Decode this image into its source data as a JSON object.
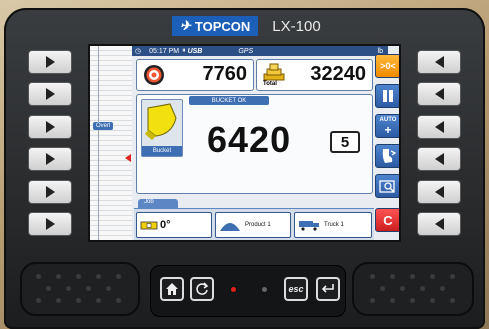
{
  "brand": {
    "logo_text": "TOPCON",
    "model": "LX-100"
  },
  "status_bar": {
    "time": "05:17 PM",
    "usb": "USB",
    "gps": "GPS",
    "unit": "lb"
  },
  "scale": {
    "overload_label": "Overl"
  },
  "counters": {
    "target_value": "7760",
    "total_value": "32240",
    "total_label": "Total"
  },
  "bucket": {
    "status_label": "BUCKET OK",
    "label": "Bucket",
    "weight": "6420",
    "pass_count": "5"
  },
  "right_buttons": [
    {
      "label": ">0<",
      "icon": "zero-icon"
    },
    {
      "label": "",
      "icon": "pause-icon"
    },
    {
      "label": "AUTO",
      "icon": "auto-add-icon"
    },
    {
      "label": "",
      "icon": "bucket-tip-icon"
    },
    {
      "label": "",
      "icon": "search-screen-icon"
    },
    {
      "label": "C",
      "icon": "clear-icon"
    }
  ],
  "job": {
    "tab_label": "Job",
    "angle": "0°",
    "product": "Product 1",
    "truck": "Truck 1"
  },
  "keypad": {
    "esc_label": "esc"
  },
  "colors": {
    "accent_blue": "#2c5ba3",
    "orange": "#f08a00",
    "red": "#cc1e1e",
    "screen_bg": "#e9edf2"
  }
}
